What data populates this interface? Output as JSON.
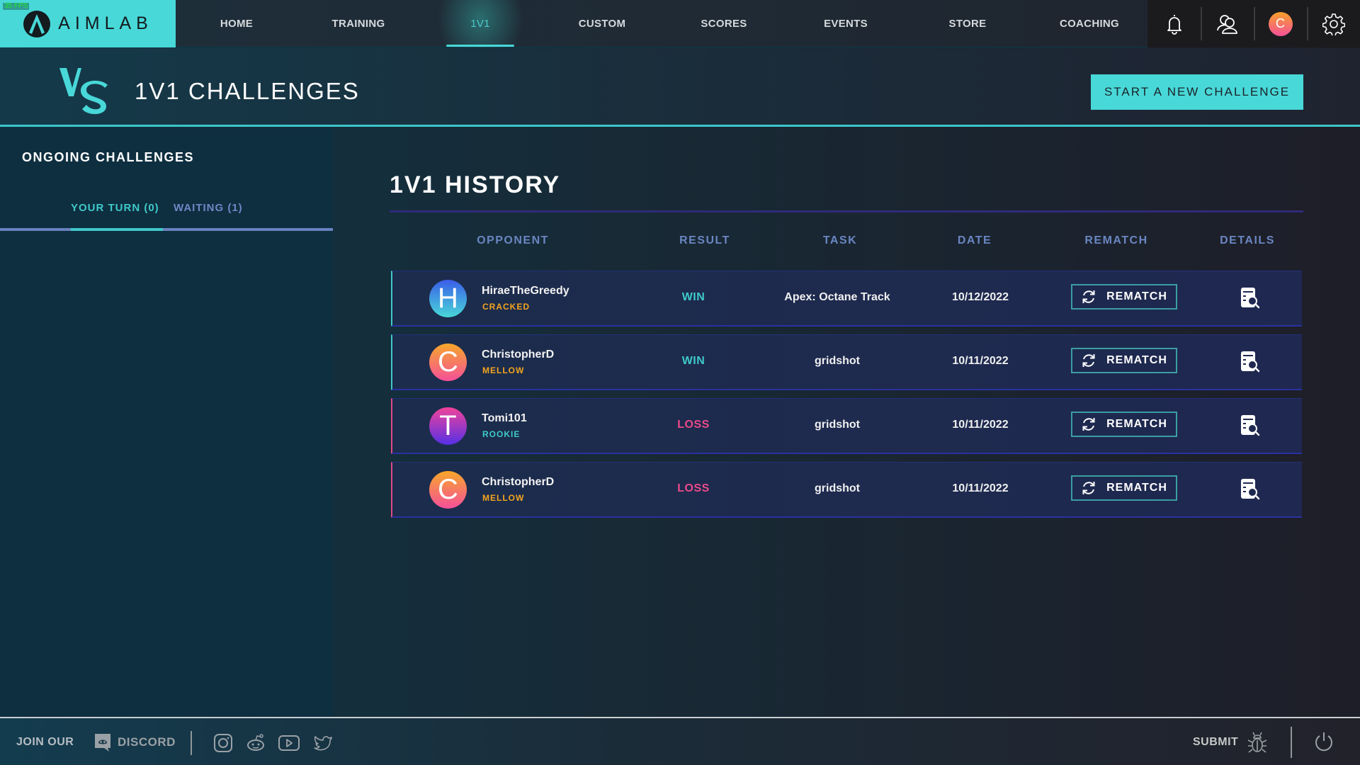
{
  "overlay": {
    "fps": "35 FPS"
  },
  "brand": {
    "name": "AIMLAB",
    "primary_color": "#48d8d8"
  },
  "nav": {
    "items": [
      {
        "label": "HOME",
        "active": false
      },
      {
        "label": "TRAINING",
        "active": false
      },
      {
        "label": "1V1",
        "active": true
      },
      {
        "label": "CUSTOM",
        "active": false
      },
      {
        "label": "SCORES",
        "active": false
      },
      {
        "label": "EVENTS",
        "active": false
      },
      {
        "label": "STORE",
        "active": false
      },
      {
        "label": "COACHING",
        "active": false
      }
    ],
    "icons": [
      "bell-icon",
      "friends-icon",
      "user-avatar",
      "gear-icon"
    ],
    "user_initial": "C"
  },
  "header": {
    "title": "1V1 CHALLENGES",
    "start_button": "START A NEW CHALLENGE"
  },
  "sidebar": {
    "title": "ONGOING CHALLENGES",
    "tabs": [
      {
        "label": "YOUR TURN (0)",
        "active": true
      },
      {
        "label": "WAITING (1)",
        "active": false
      }
    ]
  },
  "history": {
    "title": "1V1 HISTORY",
    "columns": [
      "OPPONENT",
      "RESULT",
      "TASK",
      "DATE",
      "REMATCH",
      "DETAILS"
    ],
    "rematch_label": "REMATCH",
    "rows": [
      {
        "initial": "H",
        "name": "HiraeTheGreedy",
        "rank": "CRACKED",
        "rank_color": "#f3a51e",
        "result": "WIN",
        "task": "Apex: Octane Track",
        "date": "10/12/2022",
        "avatar_gradient": [
          "#3a5ee8",
          "#48d8d8"
        ]
      },
      {
        "initial": "C",
        "name": "ChristopherD",
        "rank": "MELLOW",
        "rank_color": "#f3a51e",
        "result": "WIN",
        "task": "gridshot",
        "date": "10/11/2022",
        "avatar_gradient": [
          "#f7a72a",
          "#f5509a"
        ]
      },
      {
        "initial": "T",
        "name": "Tomi101",
        "rank": "ROOKIE",
        "rank_color": "#3fc9c9",
        "result": "LOSS",
        "task": "gridshot",
        "date": "10/11/2022",
        "avatar_gradient": [
          "#f0439a",
          "#5630e6"
        ]
      },
      {
        "initial": "C",
        "name": "ChristopherD",
        "rank": "MELLOW",
        "rank_color": "#f3a51e",
        "result": "LOSS",
        "task": "gridshot",
        "date": "10/11/2022",
        "avatar_gradient": [
          "#f7a72a",
          "#f5509a"
        ]
      }
    ],
    "result_colors": {
      "WIN": "#3fc9c9",
      "LOSS": "#ec4a8a"
    }
  },
  "footer": {
    "join_label": "JOIN OUR",
    "discord_label": "DISCORD",
    "socials": [
      "instagram-icon",
      "reddit-icon",
      "youtube-icon",
      "twitter-icon"
    ],
    "submit_label": "SUBMIT"
  }
}
